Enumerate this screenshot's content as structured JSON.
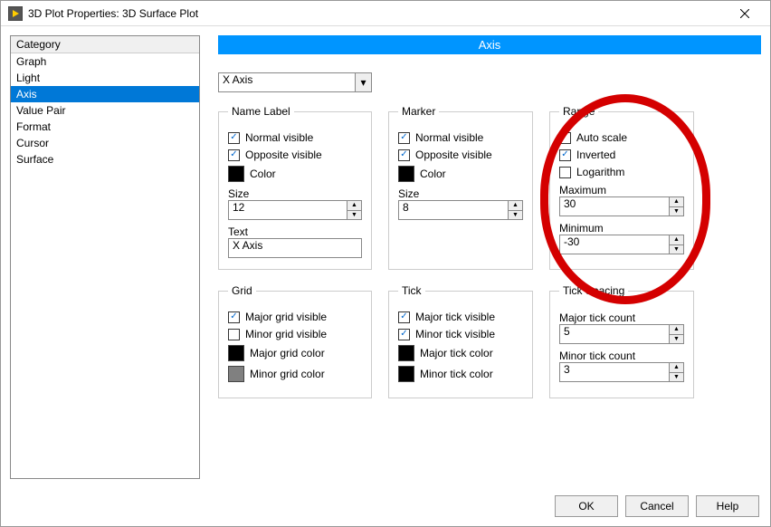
{
  "window": {
    "title": "3D Plot Properties: 3D Surface Plot"
  },
  "category": {
    "header": "Category",
    "items": [
      "Graph",
      "Light",
      "Axis",
      "Value Pair",
      "Format",
      "Cursor",
      "Surface"
    ],
    "selected_index": 2
  },
  "panel": {
    "title": "Axis",
    "axis_selector": "X Axis"
  },
  "namelabel": {
    "legend": "Name Label",
    "normal_visible": {
      "label": "Normal visible",
      "checked": true
    },
    "opposite_visible": {
      "label": "Opposite visible",
      "checked": true
    },
    "color_label": "Color",
    "color_value": "#000000",
    "size_label": "Size",
    "size_value": "12",
    "text_label": "Text",
    "text_value": "X Axis"
  },
  "marker": {
    "legend": "Marker",
    "normal_visible": {
      "label": "Normal visible",
      "checked": true
    },
    "opposite_visible": {
      "label": "Opposite visible",
      "checked": true
    },
    "color_label": "Color",
    "color_value": "#000000",
    "size_label": "Size",
    "size_value": "8"
  },
  "range": {
    "legend": "Range",
    "auto_scale": {
      "label": "Auto scale",
      "checked": false
    },
    "inverted": {
      "label": "Inverted",
      "checked": true
    },
    "logarithm": {
      "label": "Logarithm",
      "checked": false
    },
    "max_label": "Maximum",
    "max_value": "30",
    "min_label": "Minimum",
    "min_value": "-30"
  },
  "grid": {
    "legend": "Grid",
    "major_visible": {
      "label": "Major grid visible",
      "checked": true
    },
    "minor_visible": {
      "label": "Minor grid visible",
      "checked": false
    },
    "major_color_label": "Major grid color",
    "major_color_value": "#000000",
    "minor_color_label": "Minor grid color",
    "minor_color_value": "#808080"
  },
  "tick": {
    "legend": "Tick",
    "major_visible": {
      "label": "Major tick visible",
      "checked": true
    },
    "minor_visible": {
      "label": "Minor tick visible",
      "checked": true
    },
    "major_color_label": "Major tick color",
    "major_color_value": "#000000",
    "minor_color_label": "Minor tick color",
    "minor_color_value": "#000000"
  },
  "tickspacing": {
    "legend": "Tick Spacing",
    "major_label": "Major tick count",
    "major_value": "5",
    "minor_label": "Minor tick count",
    "minor_value": "3"
  },
  "buttons": {
    "ok": "OK",
    "cancel": "Cancel",
    "help": "Help"
  }
}
